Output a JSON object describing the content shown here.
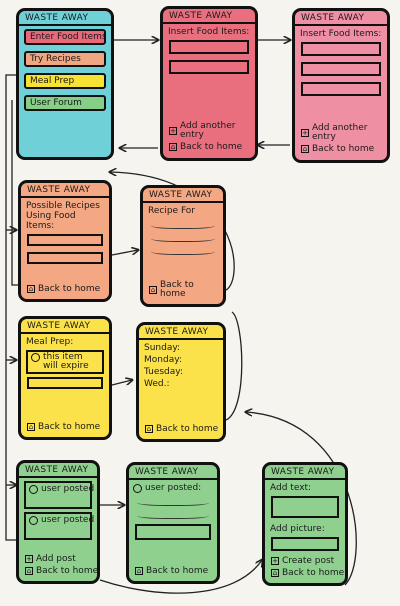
{
  "app_title": "WASTE AWAY",
  "colors": {
    "home": "#6fd0d8",
    "insert": "#e96f7f",
    "insert2": "#ef8fa3",
    "recipes": "#f3a783",
    "mealprep": "#fbe24a",
    "forum": "#8fd08f",
    "btn_enter": "#e9697a",
    "btn_recipes": "#f0a680",
    "btn_meal": "#f6e135",
    "btn_forum": "#86cf86"
  },
  "home": {
    "buttons": [
      "Enter Food Items",
      "Try Recipes",
      "Meal Prep",
      "User Forum"
    ]
  },
  "insert": {
    "label": "Insert Food Items:",
    "add": "Add another entry",
    "back": "Back to home"
  },
  "recipes": {
    "label": "Possible Recipes Using Food Items:",
    "back": "Back to home"
  },
  "recipe_detail": {
    "label": "Recipe For",
    "back": "Back to home"
  },
  "mealprep": {
    "label": "Meal Prep:",
    "warning": "this item will expire",
    "back": "Back to home"
  },
  "week": {
    "days": [
      "Sunday:",
      "Monday:",
      "Tuesday:",
      "Wed.:"
    ],
    "back": "Back to home"
  },
  "forum": {
    "posts": [
      "user posted",
      "user posted"
    ],
    "add": "Add post",
    "back": "Back to home"
  },
  "post_view": {
    "label": "user posted:",
    "back": "Back to home"
  },
  "create_post": {
    "text_label": "Add text:",
    "picture_label": "Add picture:",
    "create": "Create post",
    "back": "Back to home"
  }
}
